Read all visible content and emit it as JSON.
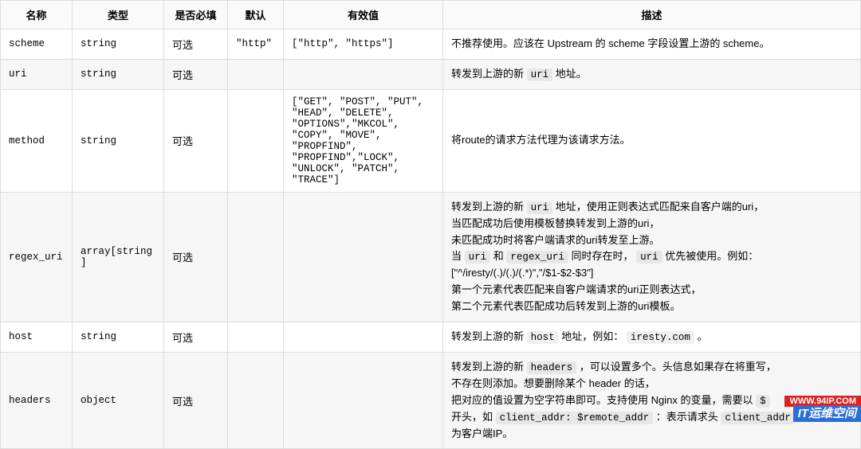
{
  "table": {
    "headers": [
      "名称",
      "类型",
      "是否必填",
      "默认",
      "有效值",
      "描述"
    ],
    "rows": [
      {
        "name": "scheme",
        "type": "string",
        "required": "可选",
        "default": "\"http\"",
        "values": "[\"http\", \"https\"]",
        "desc_segments": [
          {
            "t": "text",
            "v": "不推荐使用。应该在 Upstream 的 scheme 字段设置上游的 scheme。"
          }
        ]
      },
      {
        "name": "uri",
        "type": "string",
        "required": "可选",
        "default": "",
        "values": "",
        "desc_segments": [
          {
            "t": "text",
            "v": "转发到上游的新 "
          },
          {
            "t": "code",
            "v": "uri"
          },
          {
            "t": "text",
            "v": " 地址。"
          }
        ]
      },
      {
        "name": "method",
        "type": "string",
        "required": "可选",
        "default": "",
        "values": "[\"GET\", \"POST\", \"PUT\", \"HEAD\", \"DELETE\", \"OPTIONS\",\"MKCOL\", \"COPY\", \"MOVE\", \"PROPFIND\", \"PROPFIND\",\"LOCK\", \"UNLOCK\", \"PATCH\", \"TRACE\"]",
        "desc_segments": [
          {
            "t": "text",
            "v": "将route的请求方法代理为该请求方法。"
          }
        ]
      },
      {
        "name": "regex_uri",
        "type": "array[string]",
        "required": "可选",
        "default": "",
        "values": "",
        "desc_segments": [
          {
            "t": "text",
            "v": "转发到上游的新 "
          },
          {
            "t": "code",
            "v": "uri"
          },
          {
            "t": "text",
            "v": " 地址，使用正则表达式匹配来自客户端的uri，"
          },
          {
            "t": "br"
          },
          {
            "t": "text",
            "v": "当匹配成功后使用模板替换转发到上游的uri，"
          },
          {
            "t": "br"
          },
          {
            "t": "text",
            "v": "未匹配成功时将客户端请求的uri转发至上游。"
          },
          {
            "t": "br"
          },
          {
            "t": "text",
            "v": "当 "
          },
          {
            "t": "code",
            "v": "uri"
          },
          {
            "t": "text",
            "v": " 和 "
          },
          {
            "t": "code",
            "v": "regex_uri"
          },
          {
            "t": "text",
            "v": " 同时存在时， "
          },
          {
            "t": "code",
            "v": "uri"
          },
          {
            "t": "text",
            "v": " 优先被使用。例如："
          },
          {
            "t": "br"
          },
          {
            "t": "text",
            "v": "[\"^/iresty/(.)/(.)/(.*)\",\"/$1-$2-$3\"]"
          },
          {
            "t": "br"
          },
          {
            "t": "text",
            "v": "第一个元素代表匹配来自客户端请求的uri正则表达式，"
          },
          {
            "t": "br"
          },
          {
            "t": "text",
            "v": "第二个元素代表匹配成功后转发到上游的uri模板。"
          }
        ]
      },
      {
        "name": "host",
        "type": "string",
        "required": "可选",
        "default": "",
        "values": "",
        "desc_segments": [
          {
            "t": "text",
            "v": "转发到上游的新 "
          },
          {
            "t": "code",
            "v": "host"
          },
          {
            "t": "text",
            "v": " 地址，例如： "
          },
          {
            "t": "code",
            "v": "iresty.com"
          },
          {
            "t": "text",
            "v": " 。"
          }
        ]
      },
      {
        "name": "headers",
        "type": "object",
        "required": "可选",
        "default": "",
        "values": "",
        "desc_segments": [
          {
            "t": "text",
            "v": "转发到上游的新 "
          },
          {
            "t": "code",
            "v": "headers"
          },
          {
            "t": "text",
            "v": " ，可以设置多个。头信息如果存在将重写，"
          },
          {
            "t": "br"
          },
          {
            "t": "text",
            "v": "不存在则添加。想要删除某个 header 的话，"
          },
          {
            "t": "br"
          },
          {
            "t": "text",
            "v": "把对应的值设置为空字符串即可。支持使用 Nginx 的变量，需要以 "
          },
          {
            "t": "code",
            "v": "$"
          },
          {
            "t": "br"
          },
          {
            "t": "text",
            "v": "开头，如 "
          },
          {
            "t": "code",
            "v": "client_addr: $remote_addr"
          },
          {
            "t": "text",
            "v": " ：表示请求头 "
          },
          {
            "t": "code",
            "v": "client_addr"
          },
          {
            "t": "br"
          },
          {
            "t": "text",
            "v": "为客户端IP。"
          }
        ]
      }
    ]
  },
  "watermark": {
    "url": "WWW.94IP.COM",
    "brand": "IT运维空间"
  }
}
